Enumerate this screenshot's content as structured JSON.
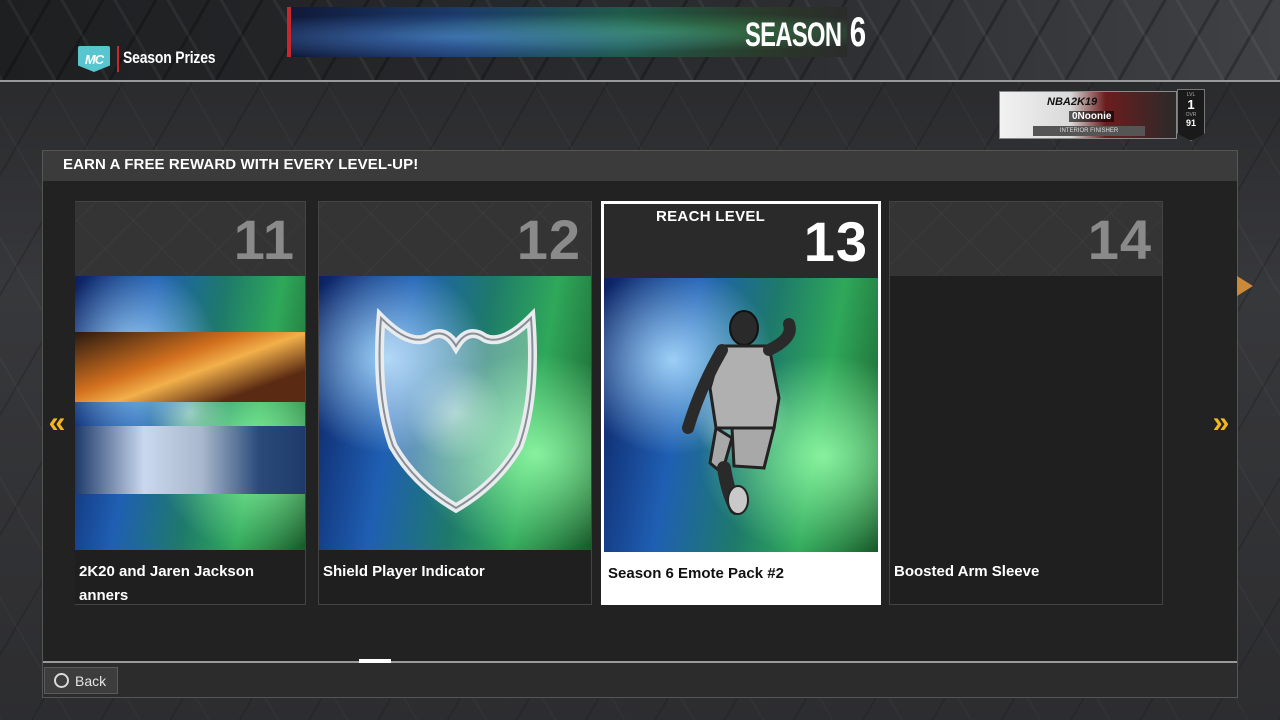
{
  "header": {
    "logo_text": "MC",
    "section_title": "Season Prizes",
    "season_label": "SEASON",
    "season_number": "6"
  },
  "player_card": {
    "game_logo": "NBA2K19",
    "gamertag": "0Noonie",
    "subline": "INTERIOR FINISHER",
    "level_label": "LVL",
    "level": "1",
    "ovr_label": "OVR",
    "ovr": "91"
  },
  "panel": {
    "title": "EARN A FREE REWARD WITH EVERY LEVEL-UP!"
  },
  "rewards": [
    {
      "level": "11",
      "name": "2K20 and Jaren Jackson\nanners",
      "name_line1": "2K20 and Jaren Jackson",
      "name_line2": "anners",
      "selected": false
    },
    {
      "level": "12",
      "name": "Shield Player Indicator",
      "selected": false
    },
    {
      "level": "13",
      "name": "Season 6 Emote Pack #2",
      "selected": true,
      "reach_label": "REACH LEVEL"
    },
    {
      "level": "14",
      "name": "Boosted Arm Sleeve",
      "selected": false
    }
  ],
  "nav": {
    "prev": "«",
    "next": "»"
  },
  "footer": {
    "back_label": "Back"
  },
  "colors": {
    "accent_yellow": "#f3b61c",
    "accent_red": "#c8272d",
    "mc_teal": "#58c6cf"
  }
}
